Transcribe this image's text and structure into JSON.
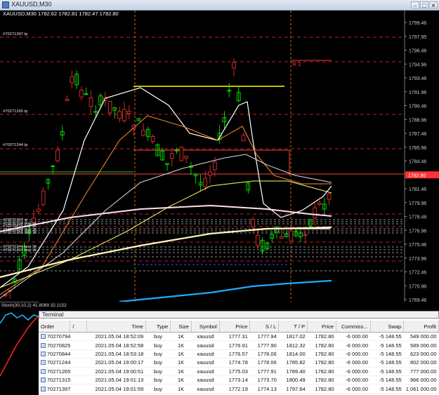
{
  "window": {
    "title": "XAUUSD,M30"
  },
  "chart": {
    "info": "XAUUSD,M30  1782.62 1782.81 1782.47 1782.80",
    "price_labels": [
      "1799.46",
      "1797.95",
      "1796.46",
      "1794.96",
      "1793.46",
      "1791.96",
      "1790.46",
      "1788.96",
      "1787.46",
      "1785.96",
      "1784.46",
      "1782.80",
      "1781.46",
      "1779.96",
      "1778.46",
      "1776.96",
      "1775.46",
      "1773.96",
      "1772.46",
      "1770.96",
      "1769.46"
    ],
    "order_labels": [
      "#70271397 tp",
      "#70271265 tp",
      "#70271244 tp",
      "#70271397 sl",
      "#70270794 buy 1K",
      "#70270825 buy 1K",
      "#70270844 buy 1K",
      "#70271265 buy 1K",
      "#70271244 buy 1K",
      "#70271397 buy 1K"
    ],
    "r_label": "R 1",
    "current_price": "1782.80",
    "colors": {
      "bull": "#00ff00",
      "bear": "#ff3333",
      "grid": "#ff2a2a",
      "ask": "#ff4444",
      "price_tag": "#ff3333"
    }
  },
  "oscillator": {
    "label": "Stoch(30,10,2) 41.8069 32.1152"
  },
  "terminal": {
    "title": "Terminal",
    "columns": [
      "Order",
      "/",
      "Time",
      "Type",
      "Size",
      "Symbol",
      "Price",
      "S / L",
      "T / P",
      "Price",
      "Commiss...",
      "Swap",
      "Profit"
    ],
    "rows": [
      {
        "order": "70270794",
        "time": "2021.05.04 18:52:09",
        "type": "buy",
        "size": "1K",
        "symbol": "xauusd",
        "price": "1777.31",
        "sl": "1777.94",
        "tp": "1817.02",
        "cur": "1782.80",
        "comm": "-6 000.00",
        "swap": "-5 148.55",
        "profit": "549 000.00"
      },
      {
        "order": "70270825",
        "time": "2021.05.04 18:52:58",
        "type": "buy",
        "size": "1K",
        "symbol": "xauusd",
        "price": "1776.91",
        "sl": "1777.90",
        "tp": "1812.32",
        "cur": "1782.80",
        "comm": "-6 000.00",
        "swap": "-5 148.55",
        "profit": "589 000.00"
      },
      {
        "order": "70270844",
        "time": "2021.05.04 18:53:18",
        "type": "buy",
        "size": "1K",
        "symbol": "xauusd",
        "price": "1776.57",
        "sl": "1778.06",
        "tp": "1814.00",
        "cur": "1782.80",
        "comm": "-6 000.00",
        "swap": "-5 148.55",
        "profit": "623 000.00"
      },
      {
        "order": "70271244",
        "time": "2021.05.04 19:00:17",
        "type": "buy",
        "size": "1K",
        "symbol": "xauusd",
        "price": "1774.78",
        "sl": "1778.06",
        "tp": "1785.82",
        "cur": "1782.80",
        "comm": "-6 000.00",
        "swap": "-5 148.55",
        "profit": "802 000.00"
      },
      {
        "order": "70271265",
        "time": "2021.05.04 19:00:51",
        "type": "buy",
        "size": "1K",
        "symbol": "xauusd",
        "price": "1775.03",
        "sl": "1777.91",
        "tp": "1789.40",
        "cur": "1782.80",
        "comm": "-6 000.00",
        "swap": "-5 148.55",
        "profit": "777 000.00"
      },
      {
        "order": "70271315",
        "time": "2021.05.04 19:01:13",
        "type": "buy",
        "size": "1K",
        "symbol": "xauusd",
        "price": "1773.14",
        "sl": "1773.70",
        "tp": "1800.49",
        "cur": "1782.80",
        "comm": "-6 000.00",
        "swap": "-5 148.55",
        "profit": "966 000.00"
      },
      {
        "order": "70271397",
        "time": "2021.05.04 19:01:59",
        "type": "buy",
        "size": "1K",
        "symbol": "xauusd",
        "price": "1772.19",
        "sl": "1774.13",
        "tp": "1797.64",
        "cur": "1782.80",
        "comm": "-6 000.00",
        "swap": "-5 148.55",
        "profit": "1 061 000.00"
      }
    ]
  }
}
